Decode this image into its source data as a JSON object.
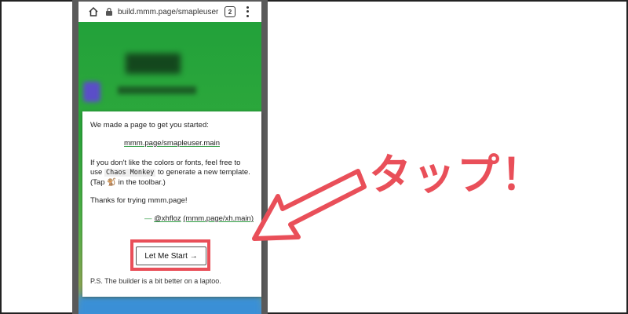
{
  "browser": {
    "url": "build.mmm.page/smapleuser.m",
    "tab_count": "2",
    "icons": [
      "home-icon",
      "lock-icon",
      "menu-icon"
    ]
  },
  "dialog": {
    "intro": "We made a page to get you started:",
    "page_link": "mmm.page/smapleuser.main",
    "customize_part1": "If you don't like the colors or fonts, feel free to use ",
    "chaos_monkey": "Chaos Monkey",
    "customize_part2": " to generate a new template. (Tap 🐒 in the toolbar.)",
    "thanks": "Thanks for trying mmm.page!",
    "sig_dash": "—",
    "sig_handle": "@xhfloz",
    "sig_site": "(mmm.page/xh.main)",
    "start_button": "Let Me Start →",
    "ps": "P.S. The builder is a bit better on a laptoo."
  },
  "annotation": {
    "label": "タップ！",
    "color": "#e94f59"
  }
}
